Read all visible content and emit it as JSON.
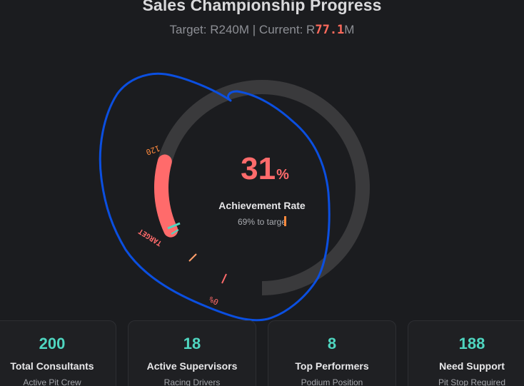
{
  "header": {
    "title": "Sales Championship Progress",
    "target_text": "Target: R240M",
    "separator": "|",
    "current_prefix": "Current: R",
    "current_value": "77.1",
    "current_suffix": "M"
  },
  "gauge": {
    "percent_value": "31",
    "percent_sign": "%",
    "label": "Achievement Rate",
    "remaining_text": "69% to targe",
    "progress_fraction": 0.31,
    "tick_labels": {
      "label_120": "120",
      "label_target": "TARGET",
      "label_zero": "0%"
    },
    "colors": {
      "track": "#3a3a3c",
      "progress": "#ff6b6b",
      "annotation": "#0b4fe0",
      "target_marker": "#4fd6c0"
    }
  },
  "cards": [
    {
      "value": "200",
      "label": "Total Consultants",
      "sub": "Active Pit Crew"
    },
    {
      "value": "18",
      "label": "Active Supervisors",
      "sub": "Racing Drivers"
    },
    {
      "value": "8",
      "label": "Top Performers",
      "sub": "Podium Position"
    },
    {
      "value": "188",
      "label": "Need Support",
      "sub": "Pit Stop Required"
    }
  ]
}
